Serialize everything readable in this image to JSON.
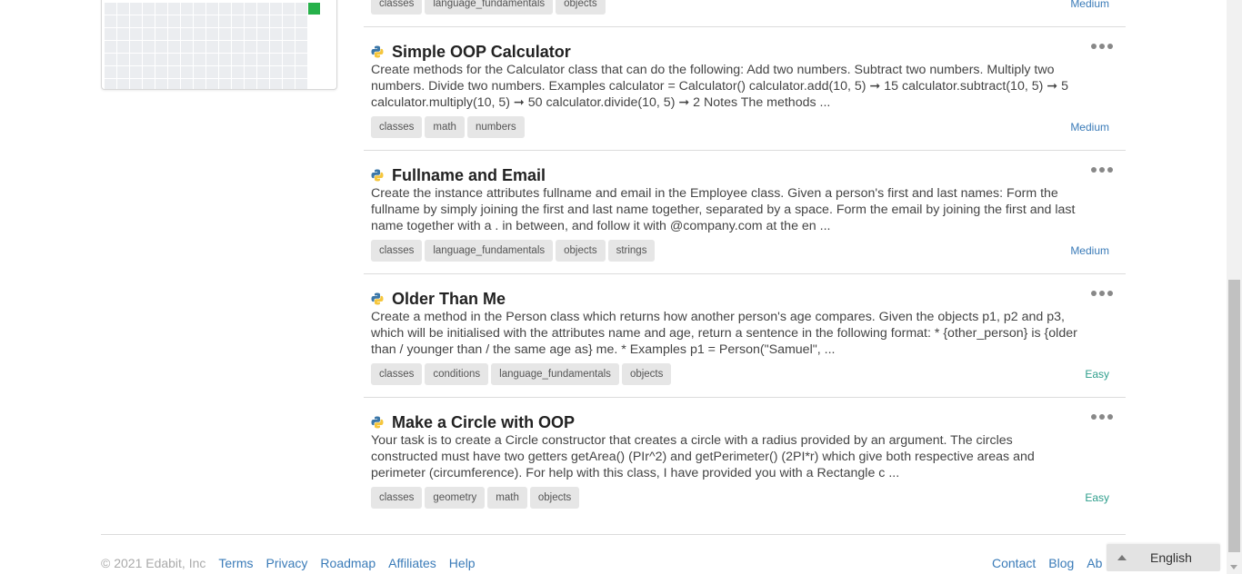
{
  "challenges": [
    {
      "title": "",
      "description": "",
      "tags": [
        "classes",
        "language_fundamentals",
        "objects"
      ],
      "difficulty": "Medium"
    },
    {
      "title": "Simple OOP Calculator",
      "description": "Create methods for the Calculator class that can do the following: Add two numbers. Subtract two numbers. Multiply two numbers. Divide two numbers. Examples calculator = Calculator() calculator.add(10, 5) ➞ 15 calculator.subtract(10, 5) ➞ 5 calculator.multiply(10, 5) ➞ 50 calculator.divide(10, 5) ➞ 2 Notes The methods ...",
      "tags": [
        "classes",
        "math",
        "numbers"
      ],
      "difficulty": "Medium"
    },
    {
      "title": "Fullname and Email",
      "description": "Create the instance attributes fullname and email in the Employee class. Given a person's first and last names: Form the fullname by simply joining the first and last name together, separated by a space. Form the email by joining the first and last name together with a . in between, and follow it with @company.com at the en ...",
      "tags": [
        "classes",
        "language_fundamentals",
        "objects",
        "strings"
      ],
      "difficulty": "Medium"
    },
    {
      "title": "Older Than Me",
      "description": "Create a method in the Person class which returns how another person's age compares. Given the objects p1, p2 and p3, which will be initialised with the attributes name and age, return a sentence in the following format: * {other_person} is {older than / younger than / the same age as} me. * Examples p1 = Person(\"Samuel\", ...",
      "tags": [
        "classes",
        "conditions",
        "language_fundamentals",
        "objects"
      ],
      "difficulty": "Easy"
    },
    {
      "title": "Make a Circle with OOP",
      "description": "Your task is to create a Circle constructor that creates a circle with a radius provided by an argument. The circles constructed must have two getters getArea() (PIr^2) and getPerimeter() (2PI*r) which give both respective areas and perimeter (circumference). For help with this class, I have provided you with a Rectangle c ...",
      "tags": [
        "classes",
        "geometry",
        "math",
        "objects"
      ],
      "difficulty": "Easy"
    }
  ],
  "footer": {
    "copyright": "© 2021 Edabit, Inc",
    "left_links": [
      "Terms",
      "Privacy",
      "Roadmap",
      "Affiliates",
      "Help"
    ],
    "right_links": [
      "Contact",
      "Blog",
      "Ab"
    ]
  },
  "language_button": {
    "label": "English"
  },
  "icons": {
    "language_icon": "python-logo-icon",
    "more_icon": "ellipsis-icon",
    "caret_icon": "caret-up-icon"
  },
  "colors": {
    "link": "#3a7bb8",
    "easy": "#2e9e8c",
    "medium": "#3a7bb8",
    "heatmap_active": "#26b14a",
    "heatmap_empty": "#ebedf0"
  }
}
